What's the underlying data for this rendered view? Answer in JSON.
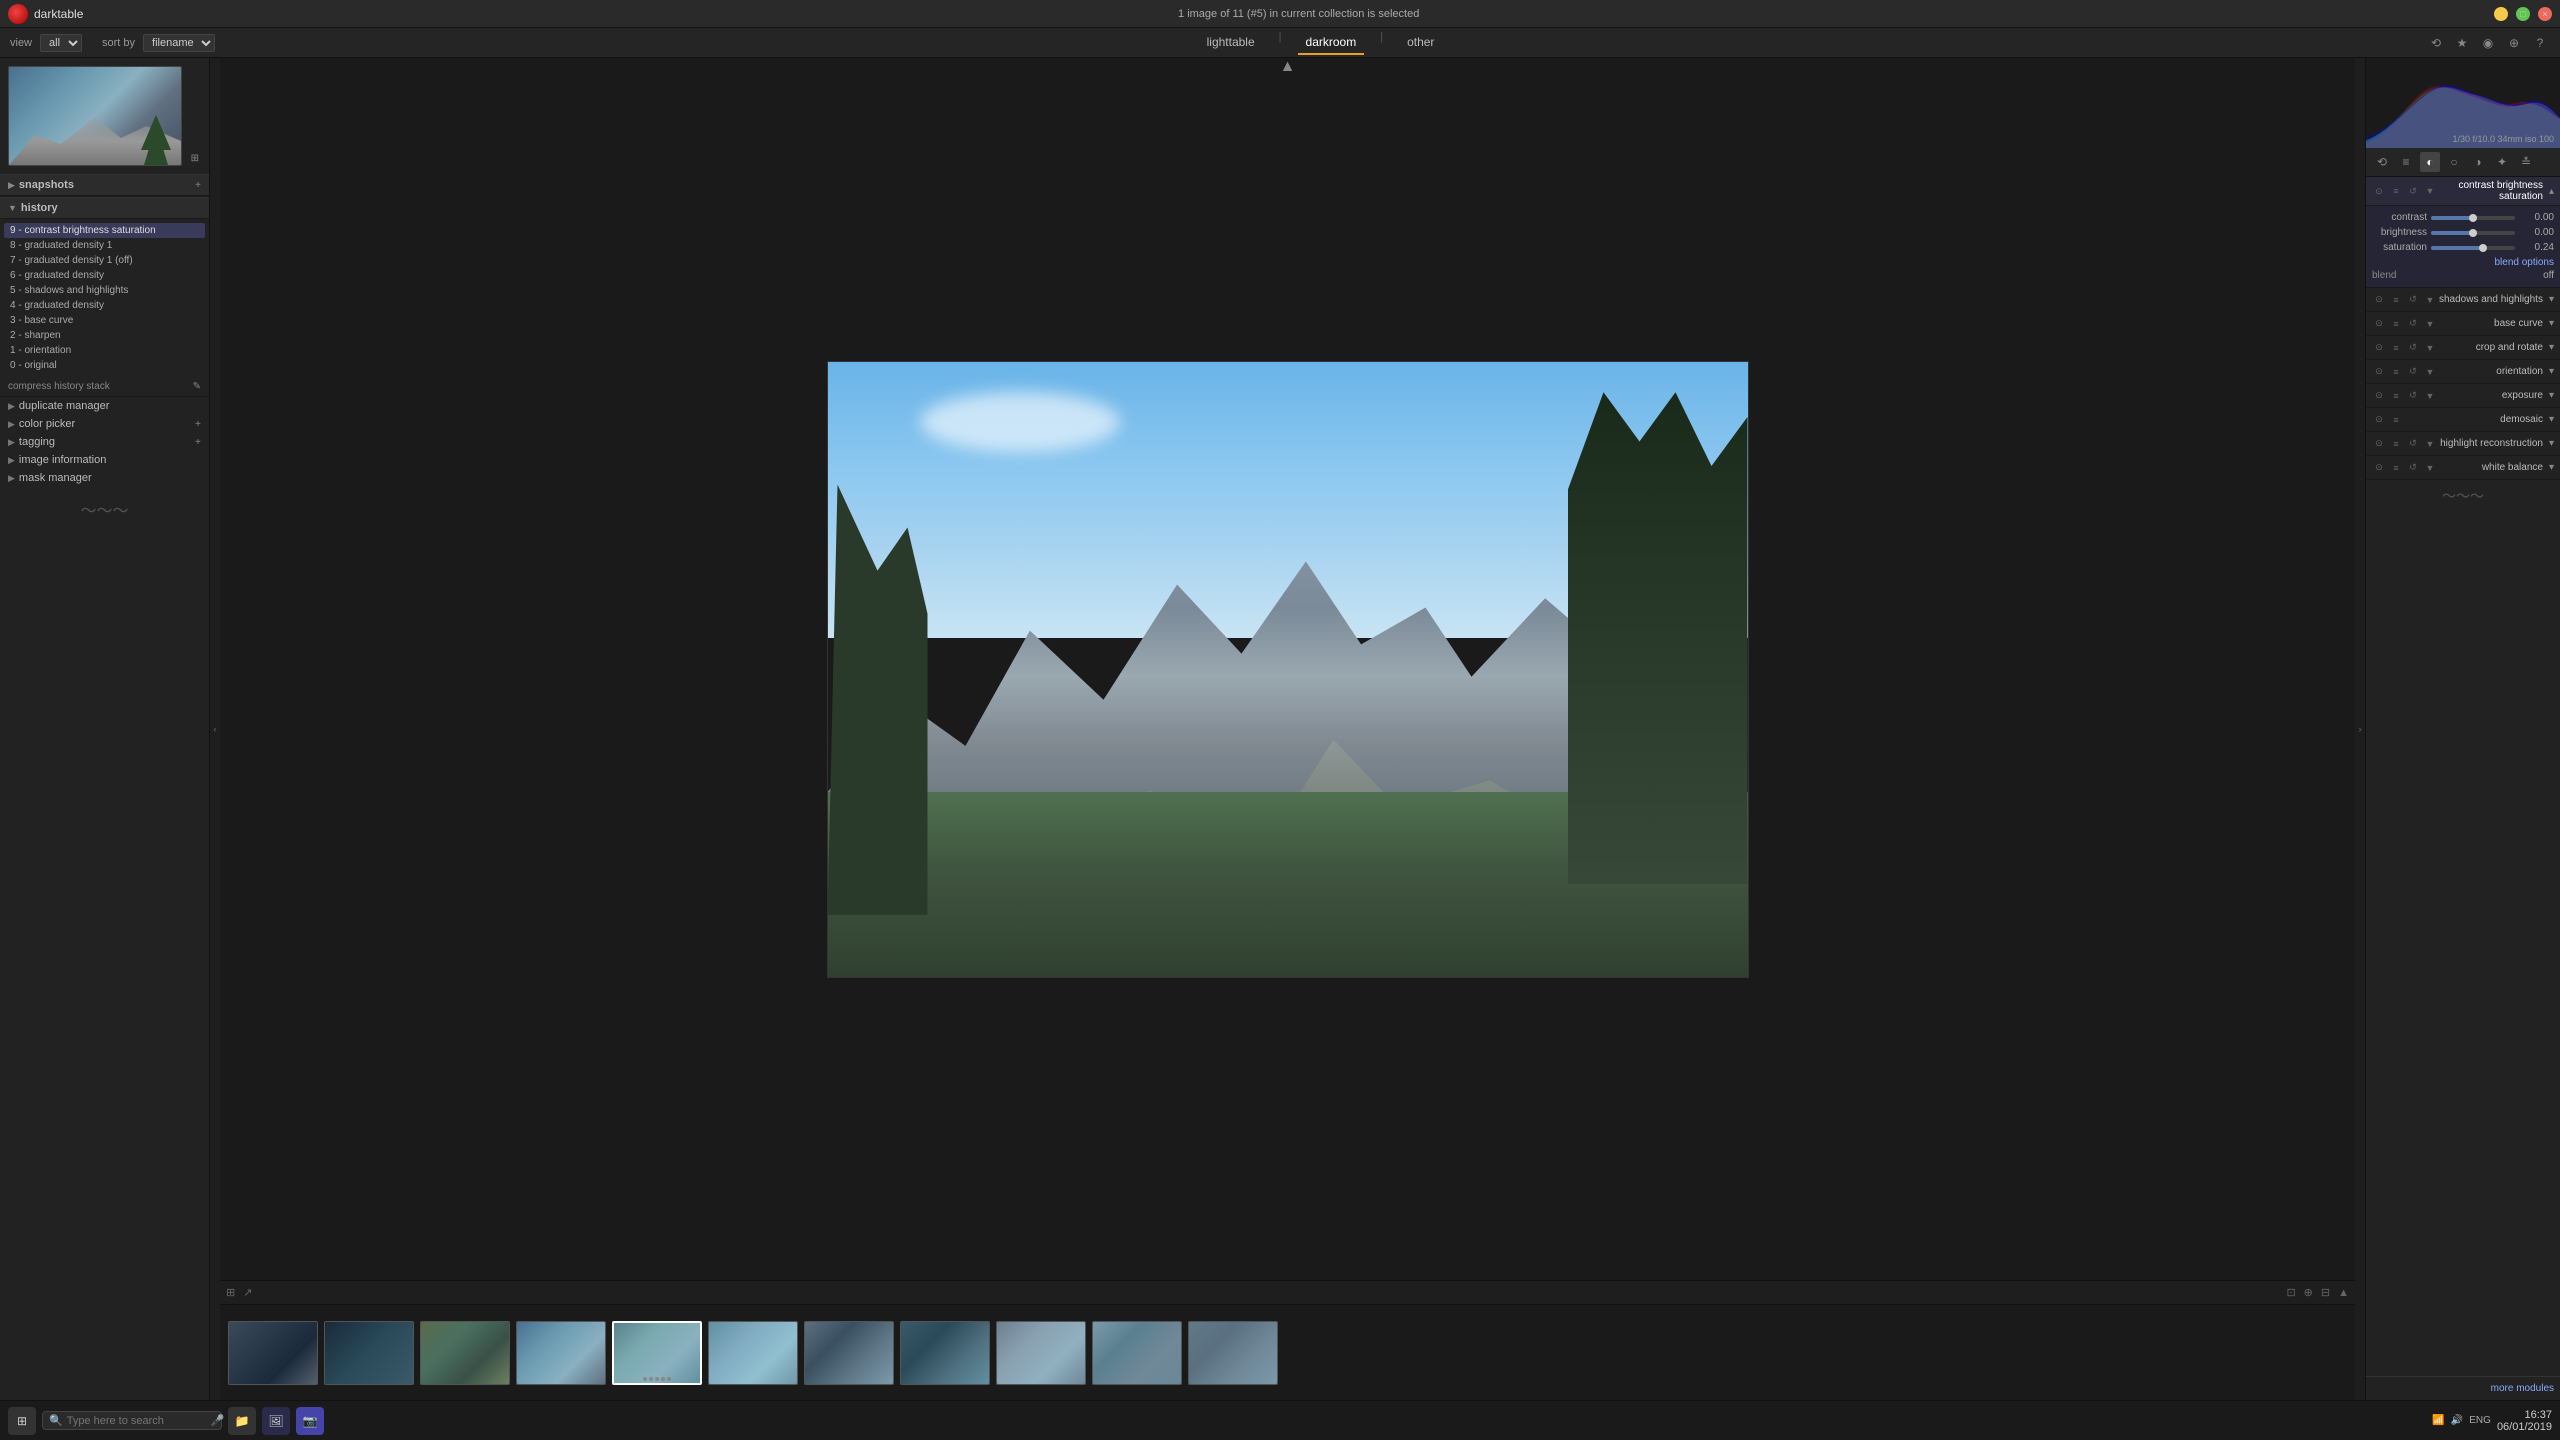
{
  "app": {
    "title": "darktable",
    "logo": "dt"
  },
  "titlebar": {
    "status": "1 image of 11 (#5) in current collection is selected"
  },
  "nav": {
    "tabs": [
      {
        "id": "lighttable",
        "label": "lighttable",
        "active": false
      },
      {
        "id": "darkroom",
        "label": "darkroom",
        "active": true
      },
      {
        "id": "other",
        "label": "other",
        "active": false
      }
    ],
    "view_label": "view",
    "view_value": "all",
    "sort_label": "sort by",
    "sort_value": "filename"
  },
  "left_panel": {
    "snapshots_label": "snapshots",
    "history_label": "history",
    "history_items": [
      {
        "id": 9,
        "label": "9 - contrast brightness saturation",
        "active": true
      },
      {
        "id": 8,
        "label": "8 - graduated density 1"
      },
      {
        "id": 7,
        "label": "7 - graduated density 1 (off)"
      },
      {
        "id": 6,
        "label": "6 - graduated density"
      },
      {
        "id": 5,
        "label": "5 - shadows and highlights"
      },
      {
        "id": 4,
        "label": "4 - graduated density"
      },
      {
        "id": 3,
        "label": "3 - base curve"
      },
      {
        "id": 2,
        "label": "2 - sharpen"
      },
      {
        "id": 1,
        "label": "1 - orientation"
      },
      {
        "id": 0,
        "label": "0 - original"
      }
    ],
    "compress_history_label": "compress history stack",
    "duplicate_manager_label": "duplicate manager",
    "color_picker_label": "color picker",
    "tagging_label": "tagging",
    "image_information_label": "image information",
    "mask_manager_label": "mask manager"
  },
  "right_panel": {
    "histogram_label": "f/10.0 34mm iso 100",
    "histogram_info": "1/30 f/10.0 34mm iso 100",
    "modules": [
      {
        "id": "contrast-brightness-saturation",
        "name": "contrast brightness saturation",
        "expanded": true,
        "sliders": [
          {
            "label": "contrast",
            "value": "0.00",
            "fill_pct": 50
          },
          {
            "label": "brightness",
            "value": "0.00",
            "fill_pct": 50
          },
          {
            "label": "saturation",
            "value": "0.24",
            "fill_pct": 62
          }
        ],
        "blend_options": "blend options",
        "blend_label": "blend",
        "blend_value": "off"
      },
      {
        "id": "shadows-highlights",
        "name": "shadows and highlights",
        "expanded": false
      },
      {
        "id": "base-curve",
        "name": "base curve",
        "expanded": false
      },
      {
        "id": "crop-rotate",
        "name": "crop and rotate",
        "expanded": false
      },
      {
        "id": "orientation",
        "name": "orientation",
        "expanded": false
      },
      {
        "id": "exposure",
        "name": "exposure",
        "expanded": false
      },
      {
        "id": "demosaic",
        "name": "demosaic",
        "expanded": false
      },
      {
        "id": "highlight-reconstruction",
        "name": "highlight reconstruction",
        "expanded": false
      },
      {
        "id": "white-balance",
        "name": "white balance",
        "expanded": false
      }
    ],
    "more_modules_label": "more modules"
  },
  "filmstrip": {
    "thumbs": [
      {
        "id": 1,
        "class": "ft1",
        "selected": false
      },
      {
        "id": 2,
        "class": "ft2",
        "selected": false
      },
      {
        "id": 3,
        "class": "ft3",
        "selected": false
      },
      {
        "id": 4,
        "class": "ft4",
        "selected": false
      },
      {
        "id": 5,
        "class": "ft5",
        "selected": true
      },
      {
        "id": 6,
        "class": "ft6",
        "selected": false
      },
      {
        "id": 7,
        "class": "ft7",
        "selected": false
      },
      {
        "id": 8,
        "class": "ft8",
        "selected": false
      },
      {
        "id": 9,
        "class": "ft9",
        "selected": false
      },
      {
        "id": 10,
        "class": "ft10",
        "selected": false
      },
      {
        "id": 11,
        "class": "ft11",
        "selected": false
      }
    ]
  },
  "taskbar": {
    "search_placeholder": "Type here to search",
    "time": "16:37",
    "date": "06/01/2019",
    "lang": "ENG"
  }
}
